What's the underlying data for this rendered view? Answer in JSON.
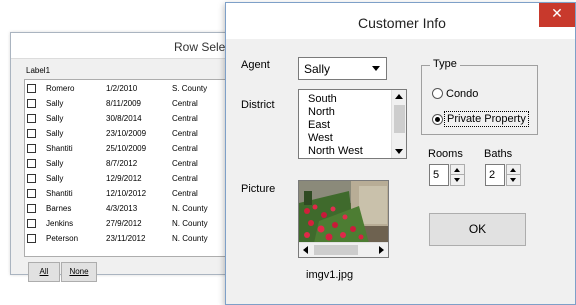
{
  "row_select_window": {
    "title": "Row Select",
    "label": "Label1",
    "rows": [
      {
        "agent": "Romero",
        "date": "1/2/2010",
        "district": "S. County"
      },
      {
        "agent": "Sally",
        "date": "8/11/2009",
        "district": "Central"
      },
      {
        "agent": "Sally",
        "date": "30/8/2014",
        "district": "Central"
      },
      {
        "agent": "Sally",
        "date": "23/10/2009",
        "district": "Central"
      },
      {
        "agent": "Shantiti",
        "date": "25/10/2009",
        "district": "Central"
      },
      {
        "agent": "Sally",
        "date": "8/7/2012",
        "district": "Central"
      },
      {
        "agent": "Sally",
        "date": "12/9/2012",
        "district": "Central"
      },
      {
        "agent": "Shantiti",
        "date": "12/10/2012",
        "district": "Central"
      },
      {
        "agent": "Barnes",
        "date": "4/3/2013",
        "district": "N. County"
      },
      {
        "agent": "Jenkins",
        "date": "27/9/2012",
        "district": "N. County"
      },
      {
        "agent": "Peterson",
        "date": "23/11/2012",
        "district": "N. County"
      }
    ],
    "all_button": "All",
    "none_button": "None"
  },
  "customer_info_window": {
    "title": "Customer Info",
    "close_glyph": "✕",
    "agent_label": "Agent",
    "agent_value": "Sally",
    "district_label": "District",
    "district_options": [
      "South",
      "North",
      "East",
      "West",
      "North West"
    ],
    "type_label": "Type",
    "type_options": [
      "Condo",
      "Private Property"
    ],
    "type_selected": "Private Property",
    "rooms_label": "Rooms",
    "rooms_value": "5",
    "baths_label": "Baths",
    "baths_value": "2",
    "ok_button": "OK",
    "picture_label": "Picture",
    "picture_caption": "imgv1.jpg",
    "accent_close_color": "#c8392c"
  }
}
